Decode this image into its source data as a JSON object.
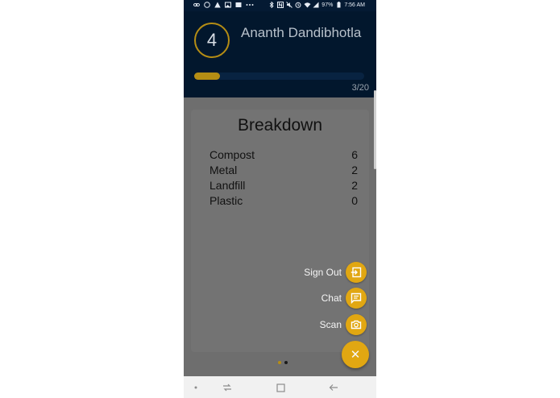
{
  "status_bar": {
    "battery": "97%",
    "time": "7:56 AM",
    "left_icons": [
      "link-icon",
      "vpn-icon",
      "warning-icon",
      "image-icon",
      "image-icon",
      "more-icon"
    ],
    "right_icons": [
      "bluetooth-icon",
      "nfc-icon",
      "mute-icon",
      "alarm-icon",
      "wifi-icon",
      "signal-icon",
      "battery-icon"
    ]
  },
  "profile": {
    "level": "4",
    "name": "Ananth Dandibhotla",
    "progress_current": 3,
    "progress_total": 20,
    "progress_text": "3/20",
    "progress_fraction": 0.15
  },
  "breakdown": {
    "title": "Breakdown",
    "items": [
      {
        "label": "Compost",
        "value": "6"
      },
      {
        "label": "Metal",
        "value": "2"
      },
      {
        "label": "Landfill",
        "value": "2"
      },
      {
        "label": "Plastic",
        "value": "0"
      }
    ]
  },
  "fab_menu": {
    "sign_out": "Sign Out",
    "chat": "Chat",
    "scan": "Scan",
    "close_icon": "close-icon"
  },
  "pager": {
    "pages": 2,
    "active": 0,
    "active_color": "#b58d14",
    "inactive_color": "#1a1a1a"
  },
  "colors": {
    "header_bg": "#02172d",
    "accent": "#e1a712",
    "overlay": "#6e6e6e"
  }
}
